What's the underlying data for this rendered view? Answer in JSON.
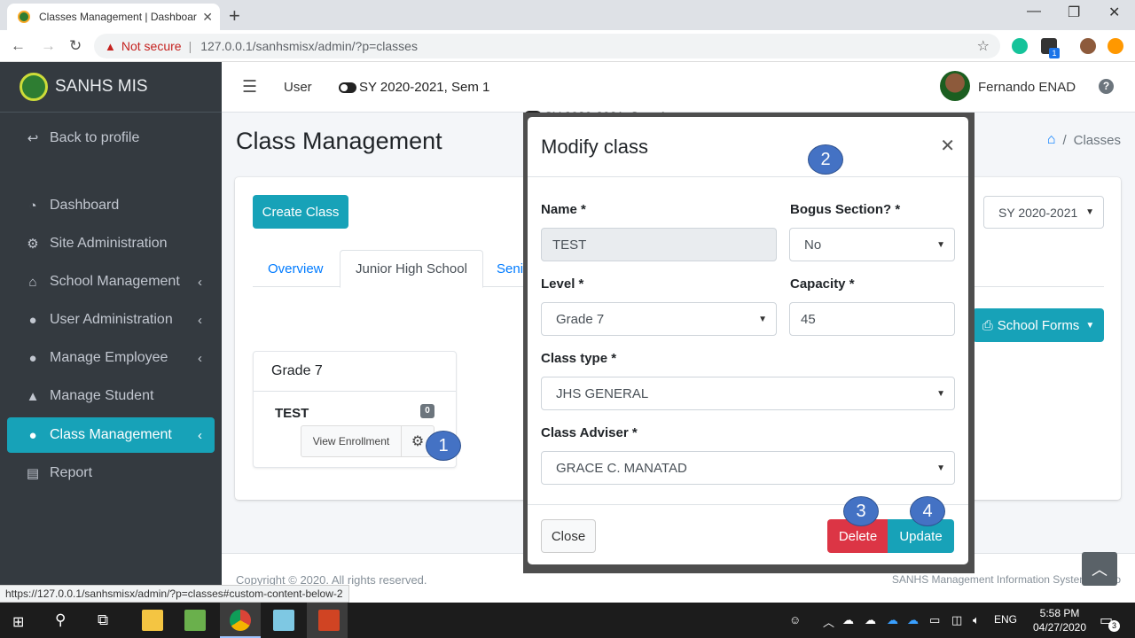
{
  "browser": {
    "tab_title": "Classes Management | Dashboar",
    "not_secure": "Not secure",
    "url": "127.0.0.1/sanhsmisx/admin/?p=classes",
    "status_url": "https://127.0.0.1/sanhsmisx/admin/?p=classes#custom-content-below-2",
    "ext_badge": "1"
  },
  "sidebar": {
    "brand": "SANHS MIS",
    "items": [
      {
        "label": "Back to profile",
        "icon": "reply-icon"
      },
      {
        "label": "Dashboard",
        "icon": "tachometer-icon"
      },
      {
        "label": "Site Administration",
        "icon": "cogs-icon"
      },
      {
        "label": "School Management",
        "icon": "school-icon"
      },
      {
        "label": "User Administration",
        "icon": "user-icon"
      },
      {
        "label": "Manage Employee",
        "icon": "user-icon"
      },
      {
        "label": "Manage Student",
        "icon": "graduate-icon"
      },
      {
        "label": "Class Management",
        "icon": "user-icon"
      },
      {
        "label": "Report",
        "icon": "file-icon"
      }
    ]
  },
  "topnav": {
    "user": "User",
    "sy": "SY 2020-2021, Sem 1",
    "username": "Fernando ENAD"
  },
  "page": {
    "title": "Class Management",
    "breadcrumb": "Classes",
    "create_button": "Create Class",
    "tabs": [
      "Overview",
      "Junior High School",
      "Senio"
    ],
    "sy_select": "SY 2020-2021",
    "school_forms": "School Forms",
    "grade_card": {
      "title": "Grade 7",
      "class_name": "TEST",
      "count": "0",
      "view_enrollment": "View Enrollment"
    }
  },
  "footer": {
    "copyright": "Copyright © 2020. All rights reserved.",
    "version": "SANHS Management Information System Versio"
  },
  "modal": {
    "ghost_text": "SY 2020-2021, Sem 1",
    "title": "Modify class",
    "name_label": "Name *",
    "name_value": "TEST",
    "bogus_label": "Bogus Section? *",
    "bogus_value": "No",
    "level_label": "Level *",
    "level_value": "Grade 7",
    "capacity_label": "Capacity *",
    "capacity_value": "45",
    "classtype_label": "Class type *",
    "classtype_value": "JHS GENERAL",
    "adviser_label": "Class Adviser *",
    "adviser_value": "GRACE C. MANATAD",
    "close_button": "Close",
    "delete_button": "Delete",
    "update_button": "Update"
  },
  "callouts": [
    "1",
    "2",
    "3",
    "4"
  ],
  "taskbar": {
    "lang": "ENG",
    "time": "5:58 PM",
    "date": "04/27/2020",
    "notif_count": "3"
  },
  "colors": {
    "sidebar": "#343a40",
    "accent": "#17a2b8",
    "danger": "#dc3545",
    "callout": "#4472c4"
  }
}
